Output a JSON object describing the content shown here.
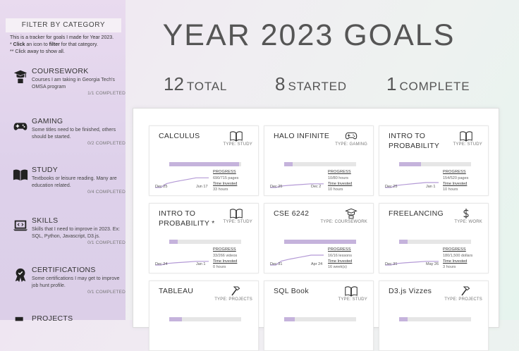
{
  "sidebar": {
    "filter_title": "FILTER BY CATEGORY",
    "intro_line1": "This is a tracker for goals I made for Year 2023.",
    "intro_line2_a": "* ",
    "intro_line2_click": "Click",
    "intro_line2_b": " an icon to ",
    "intro_line2_filter": "filter",
    "intro_line2_c": " for that category.",
    "intro_line3": "** Click away to show all.",
    "categories": [
      {
        "name": "COURSEWORK",
        "icon": "graduate-icon",
        "desc": "Courses I am taking in Georgia Tech's OMSA program",
        "count": "1/1 COMPLETED"
      },
      {
        "name": "GAMING",
        "icon": "gamepad-icon",
        "desc": "Some titles need to be finished, others should be started.",
        "count": "0/2 COMPLETED"
      },
      {
        "name": "STUDY",
        "icon": "book-icon",
        "desc": "Textbooks or leisure reading. Many are education related.",
        "count": "0/4 COMPLETED"
      },
      {
        "name": "SKILLS",
        "icon": "laptop-code-icon",
        "desc": "Skills that I need to improve in 2023. Ex: SQL, Python, Javascript, D3.js.",
        "count": "0/1 COMPLETED"
      },
      {
        "name": "CERTIFICATIONS",
        "icon": "certificate-icon",
        "desc": "Some certifications I may get to improve job hunt profile.",
        "count": "0/1 COMPLETED"
      },
      {
        "name": "PROJECTS",
        "icon": "hammer-icon",
        "desc": "",
        "count": ""
      }
    ]
  },
  "header": {
    "title": "YEAR 2023 GOALS",
    "total_num": "12",
    "total_label": "TOTAL",
    "started_num": "8",
    "started_label": "STARTED",
    "complete_num": "1",
    "complete_label": "COMPLETE"
  },
  "labels": {
    "progress": "PROGRESS",
    "time": "Time Invested"
  },
  "colors": {
    "accent": "#c5b3dc",
    "spark": "#b49ad6",
    "bar_bg": "#e6e6e6"
  },
  "goals": [
    {
      "name": "CALCULUS",
      "icon": "book-icon",
      "type": "TYPE: STUDY",
      "progress": 0.97,
      "progress_text": "690/715 pages",
      "time": "33 hours",
      "date_start": "Dec 25",
      "date_end": "Jun 17"
    },
    {
      "name": "HALO INFINITE",
      "icon": "gamepad-icon",
      "type": "TYPE: GAMING",
      "progress": 0.12,
      "progress_text": "10/80 hours",
      "time": "10 hours",
      "date_start": "Dec 25",
      "date_end": "Dec 2"
    },
    {
      "name": "INTRO TO PROBABILITY",
      "icon": "book-icon",
      "type": "TYPE: STUDY",
      "progress": 0.3,
      "progress_text": "154/520 pages",
      "time": "10 hours",
      "date_start": "Dec 25",
      "date_end": "Jan 1"
    },
    {
      "name": "INTRO TO PROBABILITY *",
      "icon": "book-icon",
      "type": "TYPE: STUDY",
      "progress": 0.12,
      "progress_text": "33/266 videos",
      "time": "0 hours",
      "date_start": "Dec 24",
      "date_end": "Jan 1"
    },
    {
      "name": "CSE 6242",
      "icon": "graduate-icon",
      "type": "TYPE: COURSEWORK",
      "progress": 1.0,
      "progress_text": "16/16 lessons",
      "time": "16 week(s)",
      "date_start": "Dec 31",
      "date_end": "Apr 24"
    },
    {
      "name": "FREELANCING",
      "icon": "dollar-icon",
      "type": "TYPE: WORK",
      "progress": 0.12,
      "progress_text": "180/1,500 dollars",
      "time": "3 hours",
      "date_start": "Dec 31",
      "date_end": "May 26"
    },
    {
      "name": "TABLEAU",
      "icon": "hammer-icon",
      "type": "TYPE: PROJECTS",
      "progress": 0.18,
      "progress_text": "",
      "time": "",
      "date_start": "",
      "date_end": ""
    },
    {
      "name": "SQL Book",
      "icon": "book-icon",
      "type": "TYPE: STUDY",
      "progress": 0.15,
      "progress_text": "",
      "time": "",
      "date_start": "",
      "date_end": ""
    },
    {
      "name": "D3.js Vizzes",
      "icon": "hammer-icon",
      "type": "TYPE: PROJECTS",
      "progress": 0.12,
      "progress_text": "",
      "time": "",
      "date_start": "",
      "date_end": ""
    }
  ]
}
